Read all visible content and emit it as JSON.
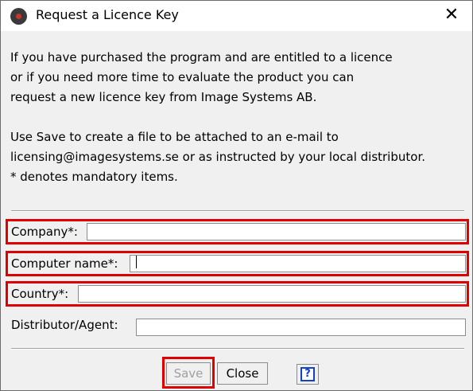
{
  "window": {
    "title": "Request a Licence Key",
    "close_glyph": "✕"
  },
  "message": {
    "line1": "If you have purchased the program and are entitled to a licence",
    "line2": "or if you need more time to evaluate the product you can",
    "line3": "request a new licence key from Image Systems AB.",
    "line4": "Use Save to create a file to be attached to an e-mail to",
    "line5": "licensing@imagesystems.se or as instructed by your local distributor.",
    "line6": "* denotes mandatory items."
  },
  "form": {
    "company_label": "Company*:",
    "company_value": "",
    "computer_label": "Computer name*:",
    "computer_value": "",
    "country_label": "Country*:",
    "country_value": "",
    "distributor_label": "Distributor/Agent:",
    "distributor_value": ""
  },
  "buttons": {
    "save": "Save",
    "close": "Close",
    "help": "?"
  },
  "colors": {
    "highlight": "#e00000",
    "help_blue": "#1540c8"
  },
  "icons": {
    "app": "app-logo-icon",
    "close": "close-icon",
    "help": "help-icon"
  }
}
